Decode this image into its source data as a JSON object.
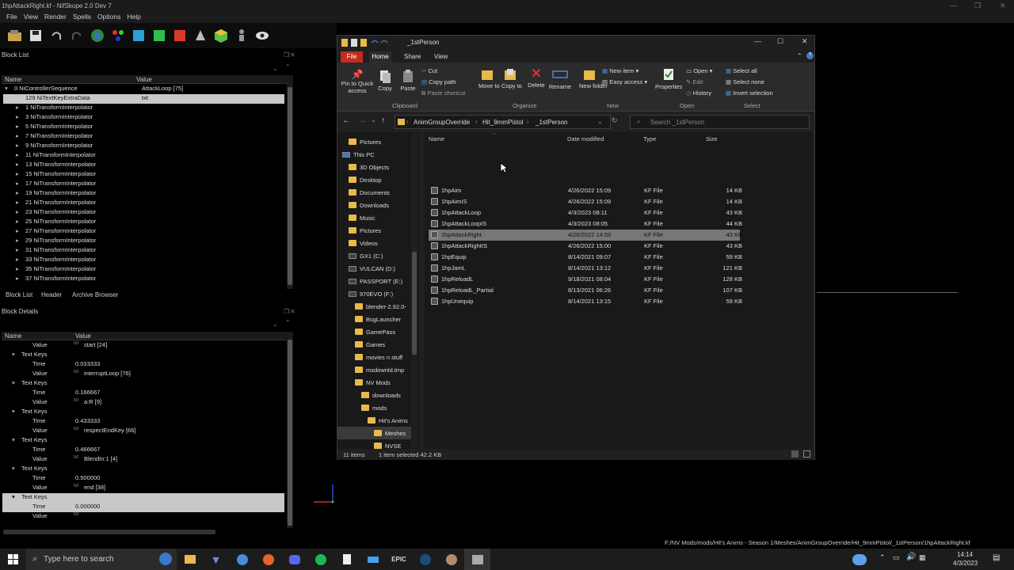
{
  "nifskope": {
    "title": "1hpAttackRight.kf - NifSkope 2.0 Dev 7",
    "menu": [
      "File",
      "View",
      "Render",
      "Spells",
      "Options",
      "Help"
    ],
    "block_list": {
      "title": "Block List",
      "columns": [
        "Name",
        "Value"
      ],
      "rows": [
        {
          "name": "0 NiControllerSequence",
          "value": "AttackLoop [75]",
          "expander": "▾",
          "indent": 0
        },
        {
          "name": "129 NiTextKeyExtraData",
          "value": "txt",
          "expander": "",
          "indent": 1,
          "selected": true
        },
        {
          "name": "1 NiTransformInterpolator",
          "value": "",
          "expander": "▸",
          "indent": 1
        },
        {
          "name": "3 NiTransformInterpolator",
          "value": "",
          "expander": "▸",
          "indent": 1
        },
        {
          "name": "5 NiTransformInterpolator",
          "value": "",
          "expander": "▸",
          "indent": 1
        },
        {
          "name": "7 NiTransformInterpolator",
          "value": "",
          "expander": "▸",
          "indent": 1
        },
        {
          "name": "9 NiTransformInterpolator",
          "value": "",
          "expander": "▸",
          "indent": 1
        },
        {
          "name": "11 NiTransformInterpolator",
          "value": "",
          "expander": "▸",
          "indent": 1
        },
        {
          "name": "13 NiTransformInterpolator",
          "value": "",
          "expander": "▸",
          "indent": 1
        },
        {
          "name": "15 NiTransformInterpolator",
          "value": "",
          "expander": "▸",
          "indent": 1
        },
        {
          "name": "17 NiTransformInterpolator",
          "value": "",
          "expander": "▸",
          "indent": 1
        },
        {
          "name": "19 NiTransformInterpolator",
          "value": "",
          "expander": "▸",
          "indent": 1
        },
        {
          "name": "21 NiTransformInterpolator",
          "value": "",
          "expander": "▸",
          "indent": 1
        },
        {
          "name": "23 NiTransformInterpolator",
          "value": "",
          "expander": "▸",
          "indent": 1
        },
        {
          "name": "25 NiTransformInterpolator",
          "value": "",
          "expander": "▸",
          "indent": 1
        },
        {
          "name": "27 NiTransformInterpolator",
          "value": "",
          "expander": "▸",
          "indent": 1
        },
        {
          "name": "29 NiTransformInterpolator",
          "value": "",
          "expander": "▸",
          "indent": 1
        },
        {
          "name": "31 NiTransformInterpolator",
          "value": "",
          "expander": "▸",
          "indent": 1
        },
        {
          "name": "33 NiTransformInterpolator",
          "value": "",
          "expander": "▸",
          "indent": 1
        },
        {
          "name": "35 NiTransformInterpolator",
          "value": "",
          "expander": "▸",
          "indent": 1
        },
        {
          "name": "37 NiTransformInterpolator",
          "value": "",
          "expander": "▸",
          "indent": 1
        }
      ],
      "tabs": [
        "Block List",
        "Header",
        "Archive Browser"
      ]
    },
    "block_details": {
      "title": "Block Details",
      "columns": [
        "Name",
        "Value"
      ],
      "rows": [
        {
          "name": "Value",
          "value": "start [24]",
          "indent": 2,
          "expander": ""
        },
        {
          "name": "Text Keys",
          "value": "",
          "indent": 1,
          "expander": "▾"
        },
        {
          "name": "Time",
          "value": "0.033333",
          "indent": 2,
          "expander": ""
        },
        {
          "name": "Value",
          "value": "interruptLoop [76]",
          "indent": 2,
          "expander": ""
        },
        {
          "name": "Text Keys",
          "value": "",
          "indent": 1,
          "expander": "▾"
        },
        {
          "name": "Time",
          "value": "0.166667",
          "indent": 2,
          "expander": ""
        },
        {
          "name": "Value",
          "value": "a:R [9]",
          "indent": 2,
          "expander": ""
        },
        {
          "name": "Text Keys",
          "value": "",
          "indent": 1,
          "expander": "▾"
        },
        {
          "name": "Time",
          "value": "0.433333",
          "indent": 2,
          "expander": ""
        },
        {
          "name": "Value",
          "value": "respectEndKey [66]",
          "indent": 2,
          "expander": ""
        },
        {
          "name": "Text Keys",
          "value": "",
          "indent": 1,
          "expander": "▾"
        },
        {
          "name": "Time",
          "value": "0.466667",
          "indent": 2,
          "expander": ""
        },
        {
          "name": "Value",
          "value": "BlendIn:1 [4]",
          "indent": 2,
          "expander": ""
        },
        {
          "name": "Text Keys",
          "value": "",
          "indent": 1,
          "expander": "▾"
        },
        {
          "name": "Time",
          "value": "0.500000",
          "indent": 2,
          "expander": ""
        },
        {
          "name": "Value",
          "value": "end [38]",
          "indent": 2,
          "expander": ""
        },
        {
          "name": "Text Keys",
          "value": "",
          "indent": 1,
          "expander": "▾",
          "selected": true
        },
        {
          "name": "Time",
          "value": "0.000000",
          "indent": 2,
          "expander": "",
          "selected": true
        },
        {
          "name": "Value",
          "value": "",
          "indent": 2,
          "expander": ""
        }
      ]
    },
    "status_path": "F:/NV Mods/mods/Hit's Anims - Season 1/Meshes/AnimGroupOverride/Hit_9mmPistol/_1stPerson/1hpAttackRight.kf"
  },
  "explorer": {
    "title": "_1stPerson",
    "tabs": [
      "File",
      "Home",
      "Share",
      "View"
    ],
    "ribbon": {
      "pin": "Pin to Quick access",
      "copy": "Copy",
      "paste": "Paste",
      "cut": "Cut",
      "copy_path": "Copy path",
      "paste_shortcut": "Paste shortcut",
      "clipboard": "Clipboard",
      "move_to": "Move to",
      "copy_to": "Copy to",
      "delete": "Delete",
      "rename": "Rename",
      "organize": "Organize",
      "new_folder": "New folder",
      "new_item": "New item",
      "easy_access": "Easy access",
      "new": "New",
      "properties": "Properties",
      "open": "Open",
      "edit": "Edit",
      "history": "History",
      "open_group": "Open",
      "select_all": "Select all",
      "select_none": "Select none",
      "invert_selection": "Invert selection",
      "select": "Select"
    },
    "breadcrumb": [
      "AnimGroupOverride",
      "Hit_9mmPistol",
      "_1stPerson"
    ],
    "search_placeholder": "Search _1stPerson",
    "nav": [
      {
        "label": "Pictures",
        "type": "folder",
        "indent": 1
      },
      {
        "label": "This PC",
        "type": "pc",
        "indent": 0
      },
      {
        "label": "3D Objects",
        "type": "folder",
        "indent": 1
      },
      {
        "label": "Desktop",
        "type": "folder",
        "indent": 1
      },
      {
        "label": "Documents",
        "type": "folder",
        "indent": 1
      },
      {
        "label": "Downloads",
        "type": "folder",
        "indent": 1
      },
      {
        "label": "Music",
        "type": "folder",
        "indent": 1
      },
      {
        "label": "Pictures",
        "type": "folder",
        "indent": 1
      },
      {
        "label": "Videos",
        "type": "folder",
        "indent": 1
      },
      {
        "label": "GX1 (C:)",
        "type": "drive",
        "indent": 1
      },
      {
        "label": "VULCAN (D:)",
        "type": "drive",
        "indent": 1
      },
      {
        "label": "PASSPORT (E:)",
        "type": "drive",
        "indent": 1
      },
      {
        "label": "970EVO (F:)",
        "type": "drive",
        "indent": 1
      },
      {
        "label": "blender-2.92.0-",
        "type": "folder",
        "indent": 2
      },
      {
        "label": "BsgLauncher",
        "type": "folder",
        "indent": 2
      },
      {
        "label": "GamePass",
        "type": "folder",
        "indent": 2
      },
      {
        "label": "Games",
        "type": "folder",
        "indent": 2
      },
      {
        "label": "movies n stuff",
        "type": "folder",
        "indent": 2
      },
      {
        "label": "msdownld.tmp",
        "type": "folder",
        "indent": 2
      },
      {
        "label": "NV Mods",
        "type": "folder",
        "indent": 2
      },
      {
        "label": "downloads",
        "type": "folder",
        "indent": 3
      },
      {
        "label": "mods",
        "type": "folder",
        "indent": 3
      },
      {
        "label": "Hit's Anims",
        "type": "folder",
        "indent": 4
      },
      {
        "label": "Meshes",
        "type": "folder",
        "indent": 5,
        "selected": true
      },
      {
        "label": "NVSE",
        "type": "folder",
        "indent": 5
      }
    ],
    "columns": [
      "Name",
      "Date modified",
      "Type",
      "Size"
    ],
    "files": [
      {
        "name": "1hpAim",
        "date": "4/26/2022 15:09",
        "type": "KF File",
        "size": "14 KB"
      },
      {
        "name": "1hpAimIS",
        "date": "4/26/2022 15:09",
        "type": "KF File",
        "size": "14 KB"
      },
      {
        "name": "1hpAttackLoop",
        "date": "4/3/2023 08:11",
        "type": "KF File",
        "size": "43 KB"
      },
      {
        "name": "1hpAttackLoopIS",
        "date": "4/3/2023 08:05",
        "type": "KF File",
        "size": "44 KB"
      },
      {
        "name": "1hpAttackRight",
        "date": "4/26/2022 14:59",
        "type": "KF File",
        "size": "43 KB",
        "selected": true
      },
      {
        "name": "1hpAttackRightIS",
        "date": "4/26/2022 15:00",
        "type": "KF File",
        "size": "43 KB"
      },
      {
        "name": "1hpEquip",
        "date": "8/14/2021 09:07",
        "type": "KF File",
        "size": "59 KB"
      },
      {
        "name": "1hpJamL",
        "date": "8/14/2021 13:12",
        "type": "KF File",
        "size": "121 KB"
      },
      {
        "name": "1hpReloadL",
        "date": "9/18/2021 08:04",
        "type": "KF File",
        "size": "128 KB"
      },
      {
        "name": "1hpReloadL_Partial",
        "date": "8/13/2021 06:26",
        "type": "KF File",
        "size": "107 KB"
      },
      {
        "name": "1hpUnequip",
        "date": "8/14/2021 13:15",
        "type": "KF File",
        "size": "59 KB"
      }
    ],
    "status_items": "11 items",
    "status_selected": "1 item selected  42.2 KB"
  },
  "taskbar": {
    "search_placeholder": "Type here to search",
    "time": "14:14",
    "date": "4/3/2023"
  },
  "colors": {
    "accent": "#3a78c9",
    "file_tab": "#c42b1c",
    "folder": "#e9b94a"
  }
}
